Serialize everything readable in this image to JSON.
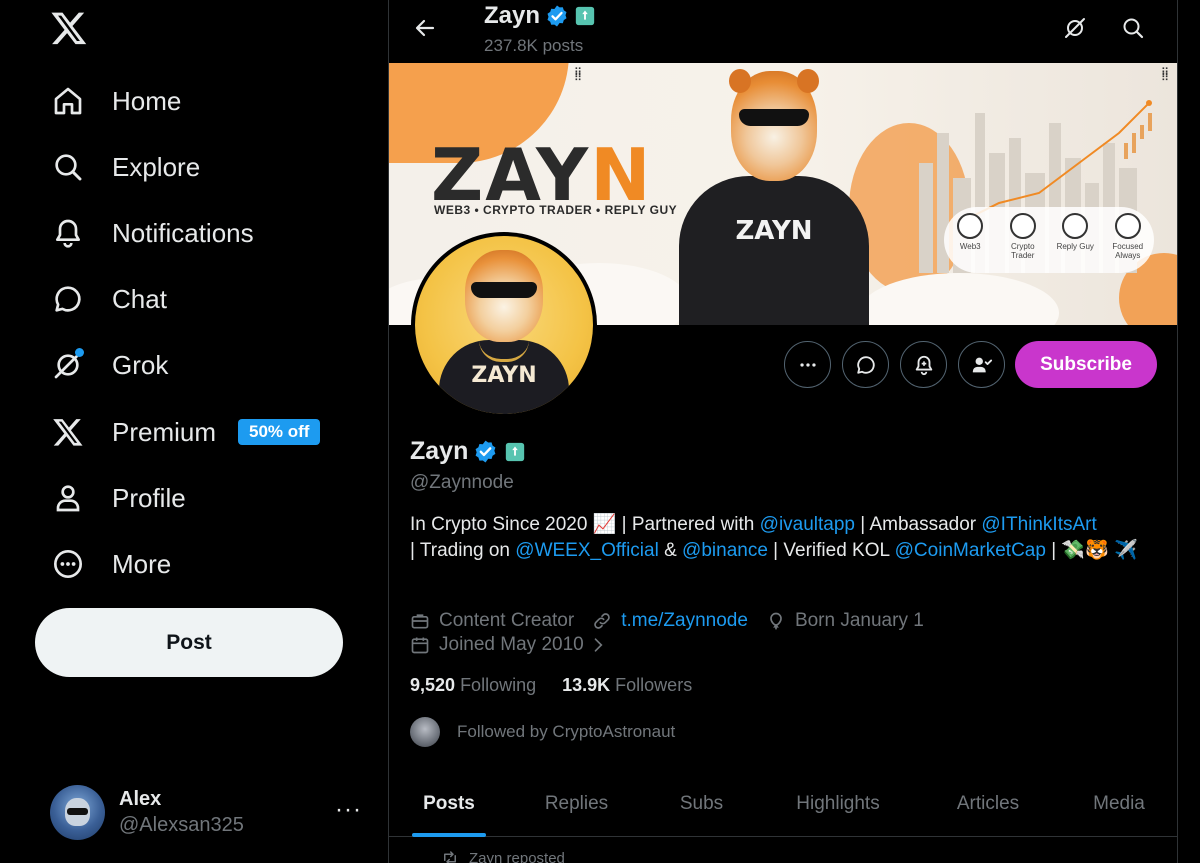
{
  "sidebar": {
    "items": [
      {
        "label": "Home",
        "icon": "home-icon"
      },
      {
        "label": "Explore",
        "icon": "search-icon"
      },
      {
        "label": "Notifications",
        "icon": "bell-icon"
      },
      {
        "label": "Chat",
        "icon": "chat-bubble-icon"
      },
      {
        "label": "Grok",
        "icon": "grok-icon"
      },
      {
        "label": "Premium",
        "icon": "x-logo-icon",
        "badge": "50% off"
      },
      {
        "label": "Profile",
        "icon": "person-icon"
      },
      {
        "label": "More",
        "icon": "more-circle-icon"
      }
    ],
    "post_label": "Post",
    "account": {
      "name": "Alex",
      "handle": "@Alexsan325",
      "more": "···"
    }
  },
  "header": {
    "name": "Zayn",
    "posts_count": "237.8K posts"
  },
  "banner": {
    "title_main": "ZAY",
    "title_accent": "N",
    "subtitle": "WEB3 • CRYPTO TRADER • REPLY GUY",
    "hoodie_text": "ZAYN",
    "badges": [
      {
        "label": "Web3"
      },
      {
        "label": "Crypto Trader"
      },
      {
        "label": "Reply Guy"
      },
      {
        "label": "Focused Always"
      }
    ]
  },
  "avatar": {
    "shirt_text": "ZAYN"
  },
  "actions": {
    "subscribe_label": "Subscribe"
  },
  "profile": {
    "name": "Zayn",
    "handle": "@Zaynnode",
    "bio": {
      "t1": "In Crypto Since 2020 📈 | Partnered with ",
      "m1": "@ivaultapp",
      "t2": " | Ambassador ",
      "m2": "@IThinkItsArt",
      "t3": " | Trading on ",
      "m3": "@WEEX_Official",
      "t4": " & ",
      "m4": "@binance",
      "t5": " | Verified KOL ",
      "m5": "@CoinMarketCap",
      "t6": " | 💸🐯 ✈️"
    },
    "category": "Content Creator",
    "link": "t.me/Zaynnode",
    "birthday": "Born January 1",
    "joined": "Joined May 2010",
    "following_count": "9,520",
    "following_label": "Following",
    "followers_count": "13.9K",
    "followers_label": "Followers",
    "followed_by": "Followed by CryptoAstronaut"
  },
  "tabs": [
    "Posts",
    "Replies",
    "Subs",
    "Highlights",
    "Articles",
    "Media"
  ],
  "active_tab": "Posts",
  "feed": {
    "repost_text": "Zayn reposted"
  },
  "colors": {
    "accent": "#1d9bf0",
    "subscribe": "#c936cc",
    "background": "#000000",
    "muted_text": "#71767b"
  }
}
